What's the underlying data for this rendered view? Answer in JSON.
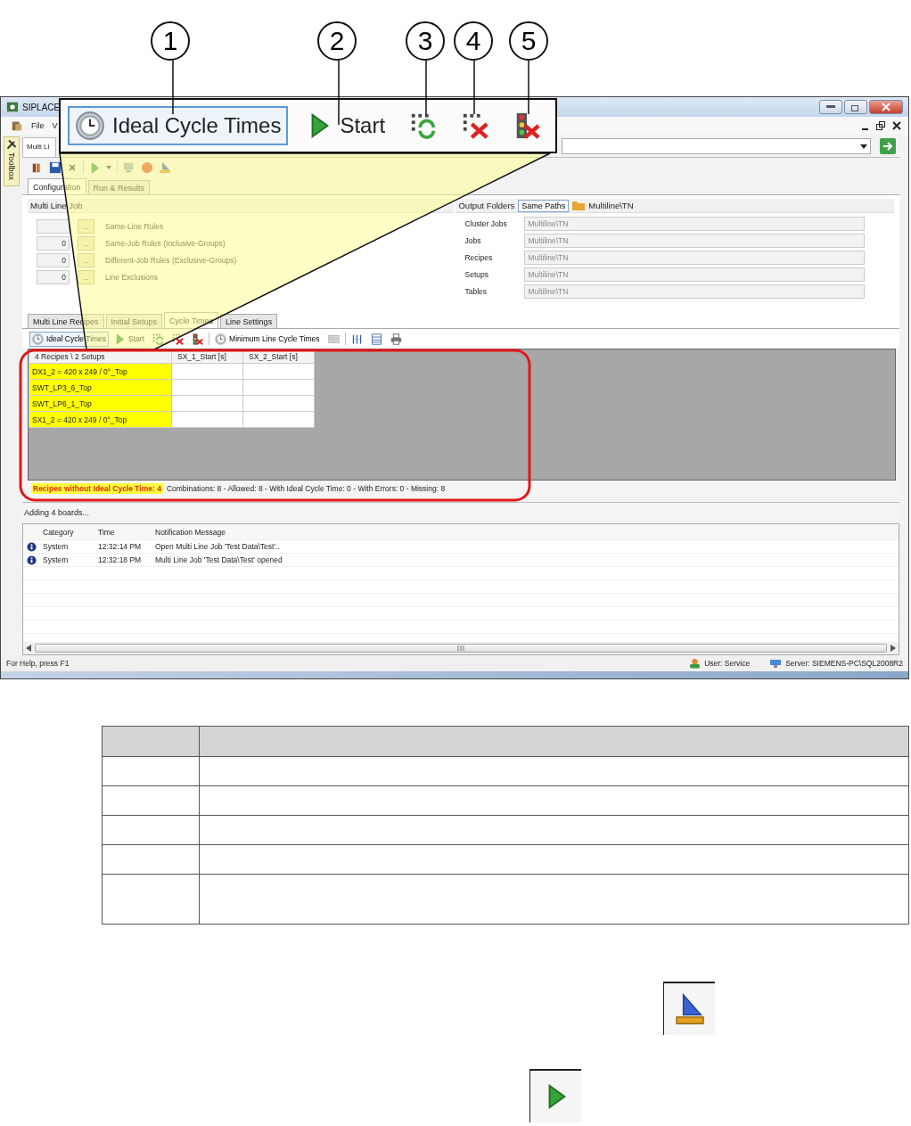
{
  "callouts": [
    "1",
    "2",
    "3",
    "4",
    "5"
  ],
  "zoom_toolbar": [
    {
      "kind": "clock",
      "label": "Ideal Cycle Times",
      "selected": true
    },
    {
      "kind": "play",
      "label": "Start",
      "selected": false
    },
    {
      "kind": "grid-refresh",
      "selected": false
    },
    {
      "kind": "grid-clear",
      "selected": false
    },
    {
      "kind": "light-clear",
      "selected": false
    }
  ],
  "window": {
    "title": "SIPLACE",
    "menu": [
      "File",
      "V"
    ],
    "toolbox": "Toolbox",
    "doc_tab": "Multi Li",
    "tabs": [
      {
        "label": "Configuration",
        "selected": true
      },
      {
        "label": "Run & Results",
        "selected": false
      }
    ]
  },
  "multi_line_job": {
    "title": "Multi Line Job",
    "rules": [
      {
        "button": "...",
        "label": "Same-Line Rules"
      },
      {
        "value": "0",
        "button": "...",
        "label": "Same-Job Rules (Inclusive-Groups)"
      },
      {
        "value": "0",
        "button": "...",
        "label": "Different-Job Rules (Exclusive-Groups)"
      },
      {
        "value": "0",
        "button": "...",
        "label": "Line Exclusions"
      }
    ]
  },
  "output_folders": {
    "title": "Output Folders",
    "same_paths": "Same Paths",
    "path": "Multiline\\TN",
    "rows": [
      {
        "label": "Cluster Jobs",
        "value": "Multiline\\TN"
      },
      {
        "label": "Jobs",
        "value": "Multiline\\TN"
      },
      {
        "label": "Recipes",
        "value": "Multiline\\TN"
      },
      {
        "label": "Setups",
        "value": "Multiline\\TN"
      },
      {
        "label": "Tables",
        "value": "Multiline\\TN"
      }
    ]
  },
  "sub_tabs": [
    {
      "label": "Multi Line Recipes",
      "selected": false
    },
    {
      "label": "Initial Setups",
      "selected": false
    },
    {
      "label": "Cycle Times",
      "selected": true
    },
    {
      "label": "Line Settings",
      "selected": false
    }
  ],
  "cycle_toolbar": [
    {
      "kind": "clock",
      "label": "Ideal Cycle Times",
      "selected": true
    },
    {
      "kind": "play",
      "label": "Start",
      "selected": false
    },
    {
      "kind": "grid-refresh",
      "selected": false
    },
    {
      "kind": "grid-clear",
      "selected": false
    },
    {
      "kind": "light-clear",
      "selected": false
    },
    {
      "kind": "clock",
      "label": "Minimum Line Cycle Times",
      "selected": false
    },
    {
      "kind": "table",
      "selected": false
    },
    {
      "kind": "columns",
      "selected": false
    },
    {
      "kind": "sheet",
      "selected": false
    },
    {
      "kind": "print",
      "selected": false
    }
  ],
  "grid": {
    "columns": [
      "4 Recipes \\ 2 Setups",
      "SX_1_Start [s]",
      "SX_2_Start [s]"
    ],
    "rows": [
      {
        "recipe": "DX1_2 = 420 x 249 / 0°_Top",
        "missing": true
      },
      {
        "recipe": "SWT_LP3_6_Top",
        "missing": true
      },
      {
        "recipe": "SWT_LP6_1_Top",
        "missing": true
      },
      {
        "recipe": "SX1_2 = 420 x 249 / 0°_Top",
        "missing": true
      }
    ],
    "warning": "Recipes without Ideal Cycle Time: 4",
    "summary": "Combinations: 8 - Allowed: 8 - With Ideal Cycle Time: 0 - With Errors: 0 - Missing: 8"
  },
  "progress_text": "Adding 4 boards...",
  "notifications": {
    "columns": [
      "Category",
      "Time",
      "Notification Message"
    ],
    "rows": [
      {
        "category": "System",
        "time": "12:32:14 PM",
        "message": "Open Multi Line Job 'Test Data\\Test'.."
      },
      {
        "category": "System",
        "time": "12:32:18 PM",
        "message": "Multi Line Job 'Test Data\\Test' opened"
      }
    ]
  },
  "status_bar": {
    "help": "For Help, press F1",
    "user": "User:  Service",
    "server": "Server:  SIEMENS-PC\\SQL2008R2"
  },
  "bottom_icons": [
    {
      "kind": "set-square"
    },
    {
      "kind": "play"
    }
  ]
}
